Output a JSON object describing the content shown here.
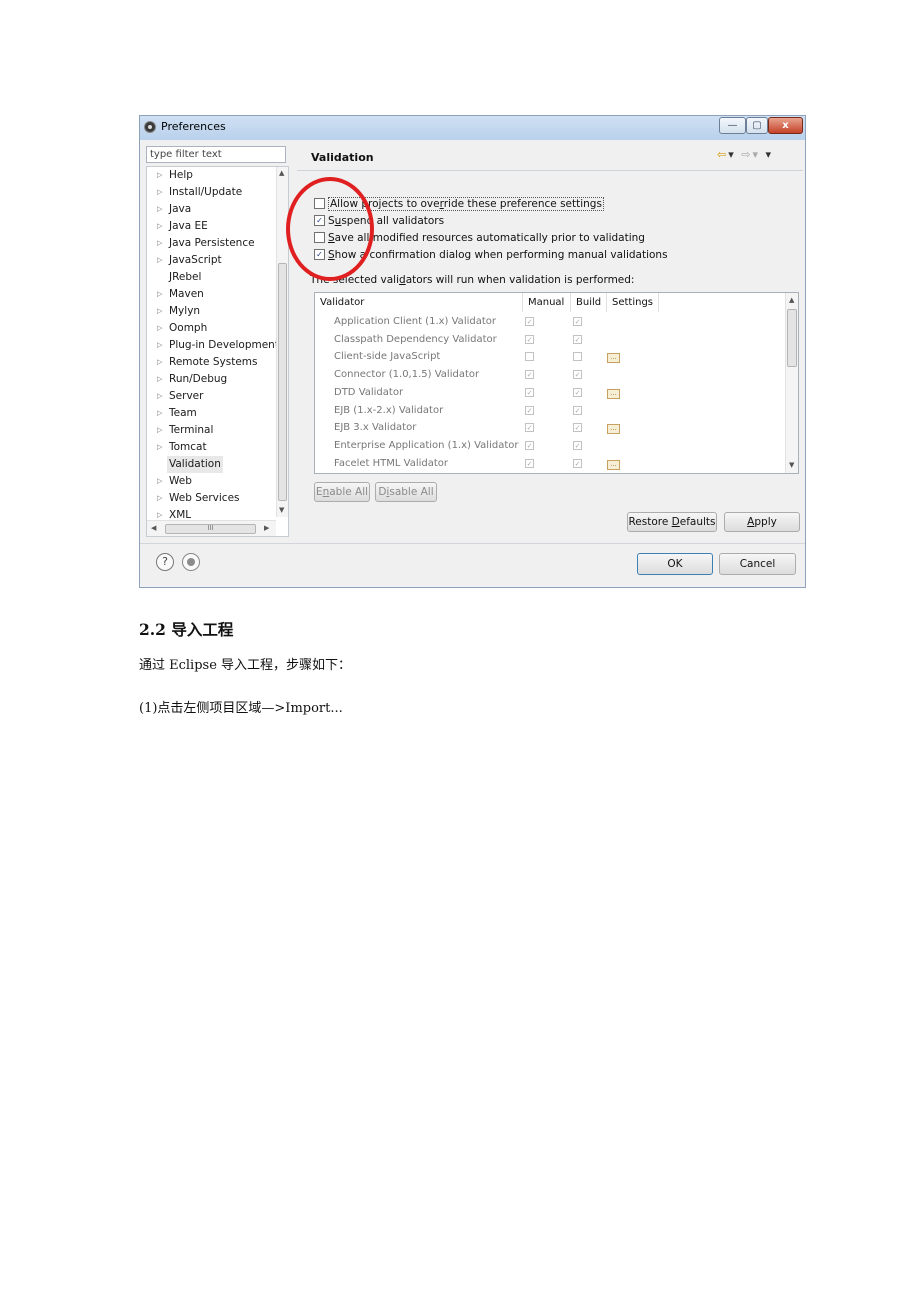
{
  "window": {
    "title": "Preferences",
    "buttons": {
      "minimize": "—",
      "maximize": "▢",
      "close": "x"
    }
  },
  "left": {
    "filter_placeholder": "type filter text",
    "tree_items": [
      {
        "label": "Help",
        "expandable": true
      },
      {
        "label": "Install/Update",
        "expandable": true
      },
      {
        "label": "Java",
        "expandable": true
      },
      {
        "label": "Java EE",
        "expandable": true
      },
      {
        "label": "Java Persistence",
        "expandable": true
      },
      {
        "label": "JavaScript",
        "expandable": true
      },
      {
        "label": "JRebel",
        "expandable": false
      },
      {
        "label": "Maven",
        "expandable": true
      },
      {
        "label": "Mylyn",
        "expandable": true
      },
      {
        "label": "Oomph",
        "expandable": true
      },
      {
        "label": "Plug-in Development",
        "expandable": true
      },
      {
        "label": "Remote Systems",
        "expandable": true
      },
      {
        "label": "Run/Debug",
        "expandable": true
      },
      {
        "label": "Server",
        "expandable": true
      },
      {
        "label": "Team",
        "expandable": true
      },
      {
        "label": "Terminal",
        "expandable": true
      },
      {
        "label": "Tomcat",
        "expandable": true
      },
      {
        "label": "Validation",
        "expandable": false,
        "selected": true
      },
      {
        "label": "Web",
        "expandable": true
      },
      {
        "label": "Web Services",
        "expandable": true
      },
      {
        "label": "XML",
        "expandable": true
      }
    ],
    "hscroll_thumb": "III"
  },
  "page": {
    "title": "Validation",
    "options": [
      {
        "label": "Allow projects to override these preference settings",
        "checked": false
      },
      {
        "label": "Suspend all validators",
        "checked": true
      },
      {
        "label": "Save all modified resources automatically prior to validating",
        "checked": false
      },
      {
        "label": "Show a confirmation dialog when performing manual validations",
        "checked": true
      }
    ],
    "selected_note": "The selected validators will run when validation is performed:",
    "table": {
      "headers": [
        "Validator",
        "Manual",
        "Build",
        "Settings"
      ],
      "rows": [
        {
          "name": "Application Client (1.x) Validator",
          "manual": true,
          "build": true,
          "settings": false
        },
        {
          "name": "Classpath Dependency Validator",
          "manual": true,
          "build": true,
          "settings": false
        },
        {
          "name": "Client-side JavaScript",
          "manual": false,
          "build": false,
          "settings": true
        },
        {
          "name": "Connector (1.0,1.5) Validator",
          "manual": true,
          "build": true,
          "settings": false
        },
        {
          "name": "DTD Validator",
          "manual": true,
          "build": true,
          "settings": true
        },
        {
          "name": "EJB (1.x-2.x) Validator",
          "manual": true,
          "build": true,
          "settings": false
        },
        {
          "name": "EJB 3.x Validator",
          "manual": true,
          "build": true,
          "settings": true
        },
        {
          "name": "Enterprise Application (1.x) Validator",
          "manual": true,
          "build": true,
          "settings": false
        },
        {
          "name": "Facelet HTML Validator",
          "manual": true,
          "build": true,
          "settings": true
        }
      ]
    },
    "enable_all": "Enable All",
    "disable_all": "Disable All",
    "restore_defaults": "Restore Defaults",
    "apply": "Apply"
  },
  "footer": {
    "ok": "OK",
    "cancel": "Cancel",
    "help_glyph": "?"
  },
  "document": {
    "heading": "2.2 导入工程",
    "para1": "通过 Eclipse 导入工程，步骤如下：",
    "para2": "(1)点击左侧项目区域—>Import..."
  }
}
